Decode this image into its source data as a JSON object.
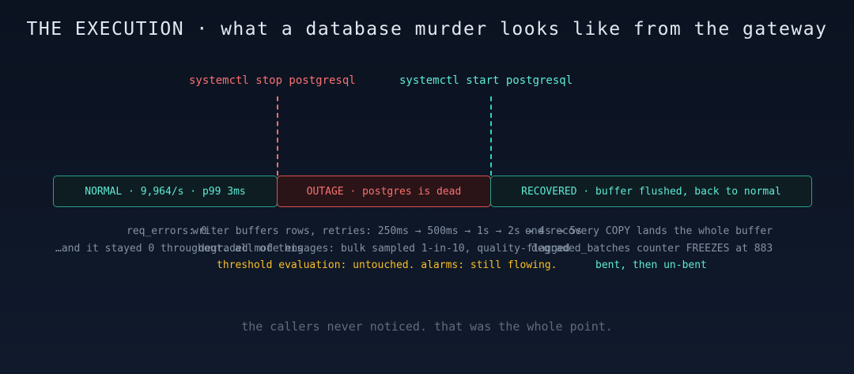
{
  "title": "THE EXECUTION · what a database murder looks like from the gateway",
  "commands": {
    "stop": "systemctl stop postgresql",
    "start": "systemctl start postgresql"
  },
  "phases": {
    "normal": "NORMAL · 9,964/s · p99 3ms",
    "outage": "OUTAGE · postgres is dead",
    "recovered": "RECOVERED · buffer flushed, back to normal"
  },
  "notes": {
    "normal": [
      "req_errors: 0",
      "…and it stayed 0 throughout. all of this"
    ],
    "outage": [
      "writer buffers rows, retries: 250ms → 500ms → 1s → 2s → 4s → 5s",
      "degraded mode engages: bulk sampled 1-in-10, quality-flagged",
      "threshold evaluation: untouched. alarms: still flowing."
    ],
    "recovered": [
      "one recovery COPY lands the whole buffer",
      "degraded_batches counter FREEZES at 883",
      "bent, then un-bent"
    ]
  },
  "footer": "the callers never noticed. that was the whole point.",
  "colors": {
    "background": "#0b1220",
    "outage": "#f87171",
    "ok": "#5eead4",
    "warn": "#fbbf24",
    "muted": "#8391a4"
  }
}
